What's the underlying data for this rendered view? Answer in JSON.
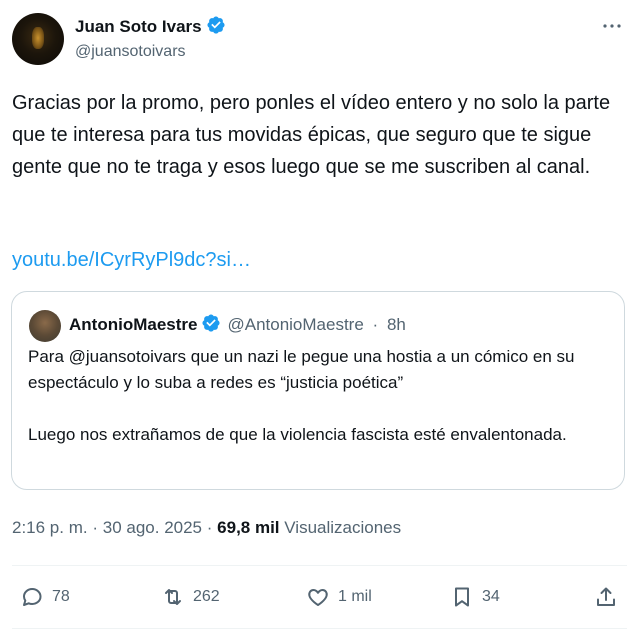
{
  "author": {
    "name": "Juan Soto Ivars",
    "handle": "@juansotoivars",
    "verified": true
  },
  "tweet": {
    "text": "Gracias por la promo, pero ponles el vídeo entero y no solo la parte que te interesa para tus movidas épicas, que seguro que te sigue gente que no te traga y esos luego que se me suscriben al canal.",
    "link": "youtu.be/ICyrRyPl9dc?si…"
  },
  "quote": {
    "name": "AntonioMaestre",
    "handle": "@AntonioMaestre",
    "time": "8h",
    "separator": "·",
    "paragraph1": "Para @juansotoivars que un nazi le pegue una hostia a un cómico en su espectáculo y lo suba a redes es “justicia poética”",
    "paragraph2": "Luego nos extrañamos de que la violencia fascista esté envalentonada."
  },
  "meta": {
    "time": "2:16 p. m.",
    "date": "30 ago. 2025",
    "views": "69,8 mil",
    "views_label": "Visualizaciones",
    "separator": "·"
  },
  "actions": {
    "replies": "78",
    "retweets": "262",
    "likes": "1 mil",
    "bookmarks": "34"
  },
  "icons": {
    "verified": "verified-badge-icon",
    "more": "more-icon",
    "reply": "reply-icon",
    "retweet": "retweet-icon",
    "like": "heart-icon",
    "bookmark": "bookmark-icon",
    "share": "share-icon"
  },
  "colors": {
    "accent": "#1d9bf0",
    "text": "#0f1419",
    "secondary": "#536471",
    "border": "#cfd9de"
  }
}
